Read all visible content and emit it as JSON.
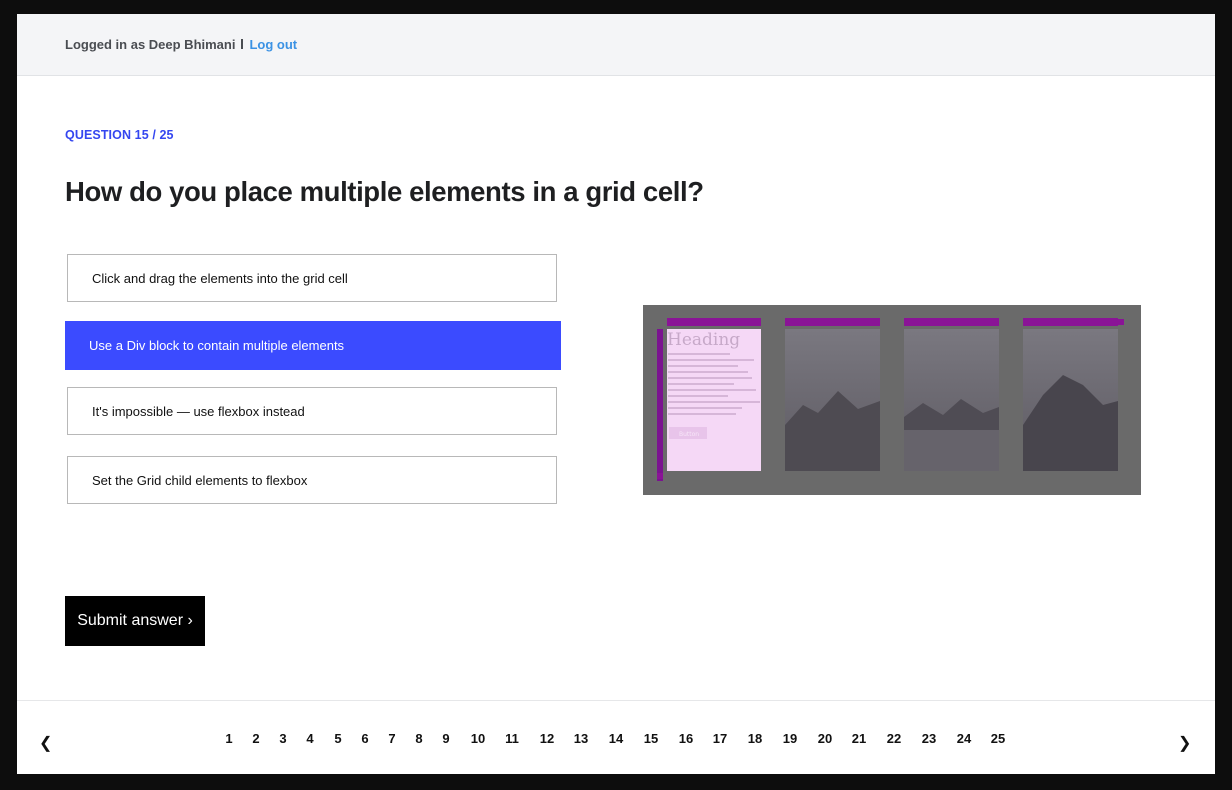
{
  "header": {
    "login_text": "Logged in as Deep Bhimani",
    "logout_label": "Log out"
  },
  "quiz": {
    "question_counter": "QUESTION 15 / 25",
    "question": "How do you place multiple elements in a grid cell?",
    "options": [
      {
        "label": "Click and drag the elements into the grid cell",
        "selected": false
      },
      {
        "label": "Use a Div block to contain multiple elements",
        "selected": true
      },
      {
        "label": "It's impossible — use flexbox instead",
        "selected": false
      },
      {
        "label": "Set the Grid child elements to flexbox",
        "selected": false
      }
    ],
    "figure": {
      "heading_text": "Heading",
      "button_text": "Button"
    },
    "submit_label": "Submit answer ›"
  },
  "pagination": {
    "prev_label": "❮",
    "next_label": "❯",
    "pages": [
      "1",
      "2",
      "3",
      "4",
      "5",
      "6",
      "7",
      "8",
      "9",
      "10",
      "11",
      "12",
      "13",
      "14",
      "15",
      "16",
      "17",
      "18",
      "19",
      "20",
      "21",
      "22",
      "23",
      "24",
      "25"
    ]
  },
  "colors": {
    "accent": "#3b4bff",
    "counter": "#3446f0",
    "link": "#3b92e4",
    "grid_purple": "#8a1496"
  }
}
